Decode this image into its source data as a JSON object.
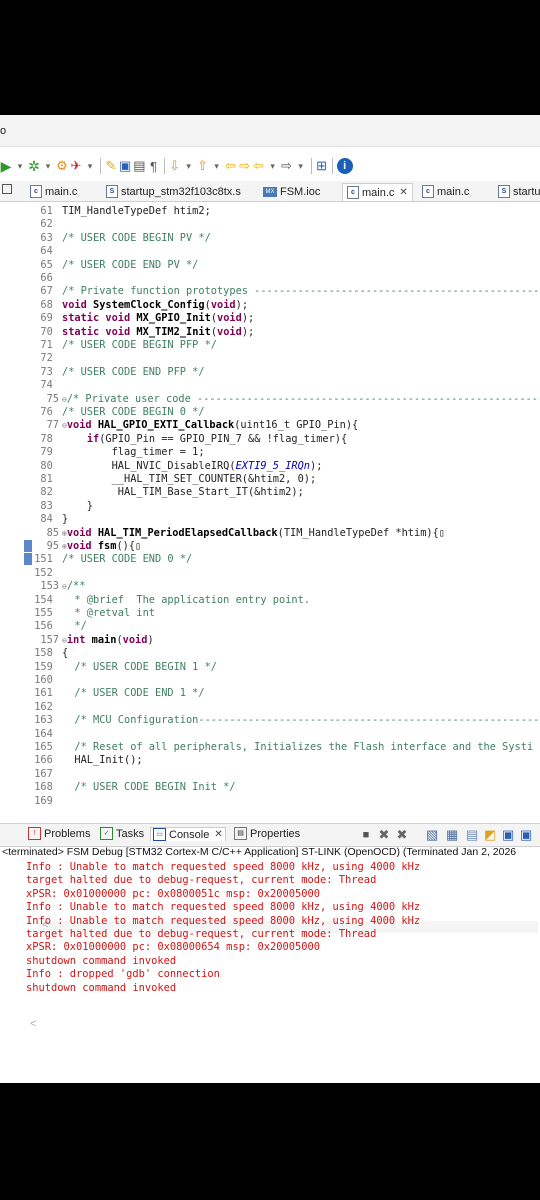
{
  "title_fragment": "o",
  "toolbar": {
    "icons": [
      "run-icon",
      "debug-icon",
      "tools-icon",
      "external-tools-icon",
      "pencil-icon",
      "highlight-icon",
      "toggle-icon",
      "paragraph-icon",
      "next-annotation-icon",
      "prev-annotation-icon",
      "back-icon",
      "forward-icon",
      "open-perspective-icon",
      "info-icon"
    ]
  },
  "tabs": [
    {
      "label": "main.c",
      "icon": "c-file-icon",
      "active": false
    },
    {
      "label": "startup_stm32f103c8tx.s",
      "icon": "s-file-icon",
      "active": false
    },
    {
      "label": "FSM.ioc",
      "icon": "mx-icon",
      "active": false
    },
    {
      "label": "main.c",
      "icon": "c-file-icon",
      "active": true,
      "close": "✕"
    },
    {
      "label": "main.c",
      "icon": "c-file-icon",
      "active": false
    },
    {
      "label": "startu",
      "icon": "s-file-icon",
      "active": false
    }
  ],
  "code_lines": [
    {
      "n": "61",
      "fold": "",
      "text": "TIM_HandleTypeDef htim2;"
    },
    {
      "n": "62",
      "fold": "",
      "text": ""
    },
    {
      "n": "63",
      "fold": "",
      "text": "/* USER CODE BEGIN PV */"
    },
    {
      "n": "64",
      "fold": "",
      "text": ""
    },
    {
      "n": "65",
      "fold": "",
      "text": "/* USER CODE END PV */"
    },
    {
      "n": "66",
      "fold": "",
      "text": ""
    },
    {
      "n": "67",
      "fold": "",
      "text": "/* Private function prototypes -----------------------------------------------"
    },
    {
      "n": "68",
      "fold": "",
      "text": "void SystemClock_Config(void);"
    },
    {
      "n": "69",
      "fold": "",
      "text": "static void MX_GPIO_Init(void);"
    },
    {
      "n": "70",
      "fold": "",
      "text": "static void MX_TIM2_Init(void);"
    },
    {
      "n": "71",
      "fold": "",
      "text": "/* USER CODE BEGIN PFP */"
    },
    {
      "n": "72",
      "fold": "",
      "text": ""
    },
    {
      "n": "73",
      "fold": "",
      "text": "/* USER CODE END PFP */"
    },
    {
      "n": "74",
      "fold": "",
      "text": ""
    },
    {
      "n": "75",
      "fold": "⊖",
      "text": "/* Private user code ---------------------------------------------------------"
    },
    {
      "n": "76",
      "fold": "",
      "text": "/* USER CODE BEGIN 0 */"
    },
    {
      "n": "77",
      "fold": "⊖",
      "text": "void HAL_GPIO_EXTI_Callback(uint16_t GPIO_Pin){"
    },
    {
      "n": "78",
      "fold": "",
      "text": "    if(GPIO_Pin == GPIO_PIN_7 && !flag_timer){"
    },
    {
      "n": "79",
      "fold": "",
      "text": "        flag_timer = 1;"
    },
    {
      "n": "80",
      "fold": "",
      "text": "        HAL_NVIC_DisableIRQ(EXTI9_5_IRQn);"
    },
    {
      "n": "81",
      "fold": "",
      "text": "        __HAL_TIM_SET_COUNTER(&htim2, 0);"
    },
    {
      "n": "82",
      "fold": "",
      "text": "         HAL_TIM_Base_Start_IT(&htim2);"
    },
    {
      "n": "83",
      "fold": "",
      "text": "    }"
    },
    {
      "n": "84",
      "fold": "",
      "text": "}"
    },
    {
      "n": "85",
      "fold": "⊕",
      "text": "void HAL_TIM_PeriodElapsedCallback(TIM_HandleTypeDef *htim){▯"
    },
    {
      "n": "95",
      "fold": "⊕",
      "text": "void fsm(){▯"
    },
    {
      "n": "151",
      "fold": "",
      "text": "/* USER CODE END 0 */"
    },
    {
      "n": "152",
      "fold": "",
      "text": ""
    },
    {
      "n": "153",
      "fold": "⊖",
      "text": "/**"
    },
    {
      "n": "154",
      "fold": "",
      "text": "  * @brief  The application entry point."
    },
    {
      "n": "155",
      "fold": "",
      "text": "  * @retval int"
    },
    {
      "n": "156",
      "fold": "",
      "text": "  */"
    },
    {
      "n": "157",
      "fold": "⊖",
      "text": "int main(void)"
    },
    {
      "n": "158",
      "fold": "",
      "text": "{"
    },
    {
      "n": "159",
      "fold": "",
      "text": "  /* USER CODE BEGIN 1 */"
    },
    {
      "n": "160",
      "fold": "",
      "text": ""
    },
    {
      "n": "161",
      "fold": "",
      "text": "  /* USER CODE END 1 */"
    },
    {
      "n": "162",
      "fold": "",
      "text": ""
    },
    {
      "n": "163",
      "fold": "",
      "text": "  /* MCU Configuration--------------------------------------------------------"
    },
    {
      "n": "164",
      "fold": "",
      "text": ""
    },
    {
      "n": "165",
      "fold": "",
      "text": "  /* Reset of all peripherals, Initializes the Flash interface and the Systi"
    },
    {
      "n": "166",
      "fold": "",
      "text": "  HAL_Init();"
    },
    {
      "n": "167",
      "fold": "",
      "text": ""
    },
    {
      "n": "168",
      "fold": "",
      "text": "  /* USER CODE BEGIN Init */"
    },
    {
      "n": "169",
      "fold": "",
      "text": ""
    }
  ],
  "panel": {
    "tabs": [
      {
        "label": "Problems",
        "icon": "problems-icon"
      },
      {
        "label": "Tasks",
        "icon": "tasks-icon"
      },
      {
        "label": "Console",
        "icon": "console-icon",
        "close": "✕"
      },
      {
        "label": "Properties",
        "icon": "properties-icon"
      }
    ],
    "info": "<terminated> FSM Debug [STM32 Cortex-M C/C++ Application] ST-LINK (OpenOCD) (Terminated Jan 2, 2026",
    "console_lines": [
      "Info : Unable to match requested speed 8000 kHz, using 4000 kHz",
      "target halted due to debug-request, current mode: Thread",
      "xPSR: 0x01000000 pc: 0x0800051c msp: 0x20005000",
      "Info : Unable to match requested speed 8000 kHz, using 4000 kHz",
      "Info : Unable to match requested speed 8000 kHz, using 4000 kHz",
      "target halted due to debug-request, current mode: Thread",
      "xPSR: 0x01000000 pc: 0x08000654 msp: 0x20005000",
      "shutdown command invoked",
      "Info : dropped 'gdb' connection",
      "shutdown command invoked"
    ]
  },
  "scroll_arrow": "<"
}
